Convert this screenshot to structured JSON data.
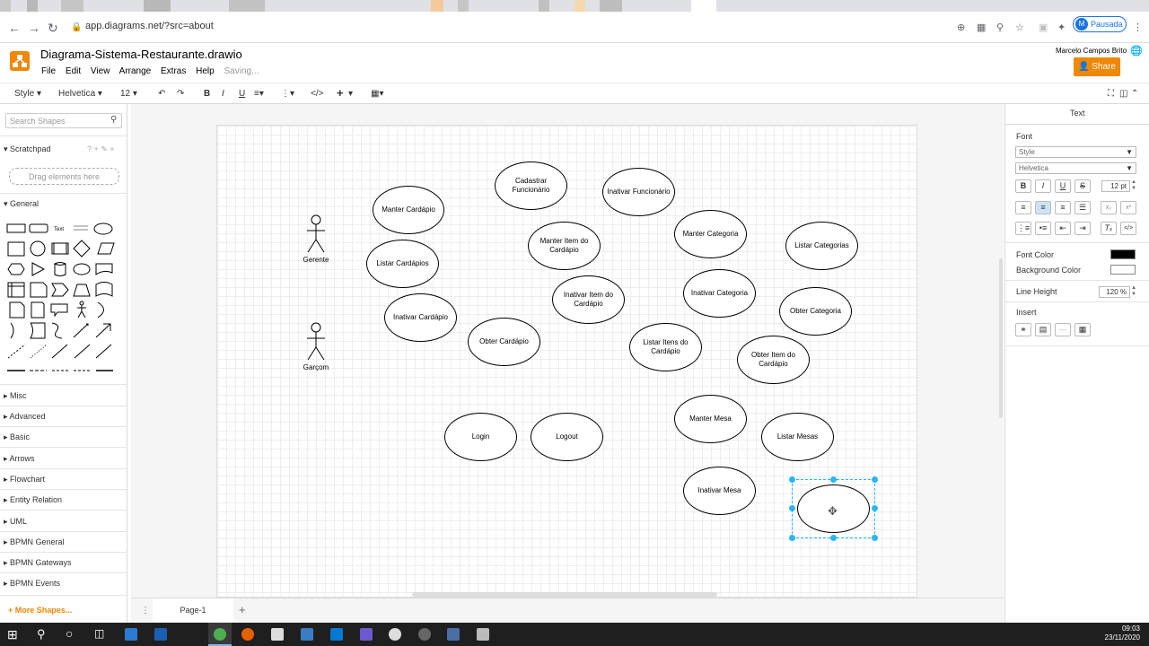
{
  "browser": {
    "url": "app.diagrams.net/?src=about",
    "profile_initial": "M",
    "profile_status": "Pausada"
  },
  "app": {
    "title": "Diagrama-Sistema-Restaurante.drawio",
    "menu": [
      "File",
      "Edit",
      "View",
      "Arrange",
      "Extras",
      "Help"
    ],
    "status": "Saving...",
    "user": "Marcelo Campos Brito",
    "share_label": "Share",
    "share_color": "#f08705"
  },
  "toolbar": {
    "style": "Style",
    "font": "Helvetica",
    "size": "12",
    "bold": "B",
    "italic": "I",
    "underline": "U"
  },
  "left": {
    "search_placeholder": "Search Shapes",
    "scratchpad": "Scratchpad",
    "drag_hint": "Drag elements here",
    "general": "General",
    "text_shape": "Text",
    "sections": [
      "Misc",
      "Advanced",
      "Basic",
      "Arrows",
      "Flowchart",
      "Entity Relation",
      "UML",
      "BPMN General",
      "BPMN Gateways",
      "BPMN Events"
    ],
    "more_shapes": "More Shapes..."
  },
  "canvas": {
    "actors": [
      "Gerente",
      "Garçom"
    ],
    "use_cases": {
      "manter_cardapio": "Manter Cardápio",
      "cadastrar_funcionario": "Cadastrar Funcionário",
      "inativar_funcionario": "Inativar Funcionário",
      "listar_cardapios": "Listar Cardápios",
      "manter_item": "Manter Item do Cardápio",
      "manter_categoria": "Manter Categoria",
      "listar_categorias": "Listar Categorias",
      "inativar_cardapio": "Inativar Cardápio",
      "inativar_item": "Inativar Item do Cardápio",
      "inativar_categoria": "Inativar Categoria",
      "obter_categoria": "Obter Categoria",
      "obter_cardapio": "Obter Cardápio",
      "listar_itens": "Listar Itens do Cardápio",
      "obter_item": "Obter Item do Cardápio",
      "login": "Login",
      "logout": "Logout",
      "manter_mesa": "Manter Mesa",
      "listar_mesas": "Listar Mesas",
      "inativar_mesa": "Inativar Mesa"
    },
    "page_tab": "Page-1"
  },
  "right": {
    "panel_title": "Text",
    "font_label": "Font",
    "style_value": "Style",
    "font_value": "Helvetica",
    "size_value": "12 pt",
    "font_color_label": "Font Color",
    "bg_color_label": "Background Color",
    "line_height_label": "Line Height",
    "line_height_value": "120 %",
    "insert_label": "Insert"
  },
  "taskbar": {
    "time": "09:03",
    "date": "23/11/2020"
  }
}
